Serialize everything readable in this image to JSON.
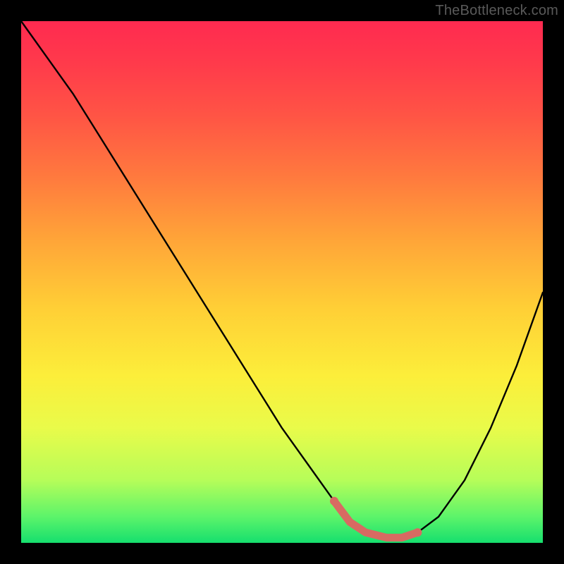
{
  "watermark": "TheBottleneck.com",
  "colors": {
    "curve": "#000000",
    "highlight": "#d86a62",
    "gradient_top": "#ff2a50",
    "gradient_bottom": "#16df6e",
    "background": "#000000"
  },
  "chart_data": {
    "type": "line",
    "title": "",
    "xlabel": "",
    "ylabel": "",
    "xlim": [
      0,
      100
    ],
    "ylim": [
      0,
      100
    ],
    "grid": false,
    "legend": false,
    "annotations": [],
    "series": [
      {
        "name": "bottleneck-curve",
        "x": [
          0,
          5,
          10,
          15,
          20,
          25,
          30,
          35,
          40,
          45,
          50,
          55,
          60,
          63,
          66,
          70,
          73,
          76,
          80,
          85,
          90,
          95,
          100
        ],
        "y": [
          100,
          93,
          86,
          78,
          70,
          62,
          54,
          46,
          38,
          30,
          22,
          15,
          8,
          4,
          2,
          1,
          1,
          2,
          5,
          12,
          22,
          34,
          48
        ]
      }
    ],
    "highlight_range_x": [
      60,
      76
    ],
    "curve_min_x": 71,
    "curve_min_y": 1
  }
}
